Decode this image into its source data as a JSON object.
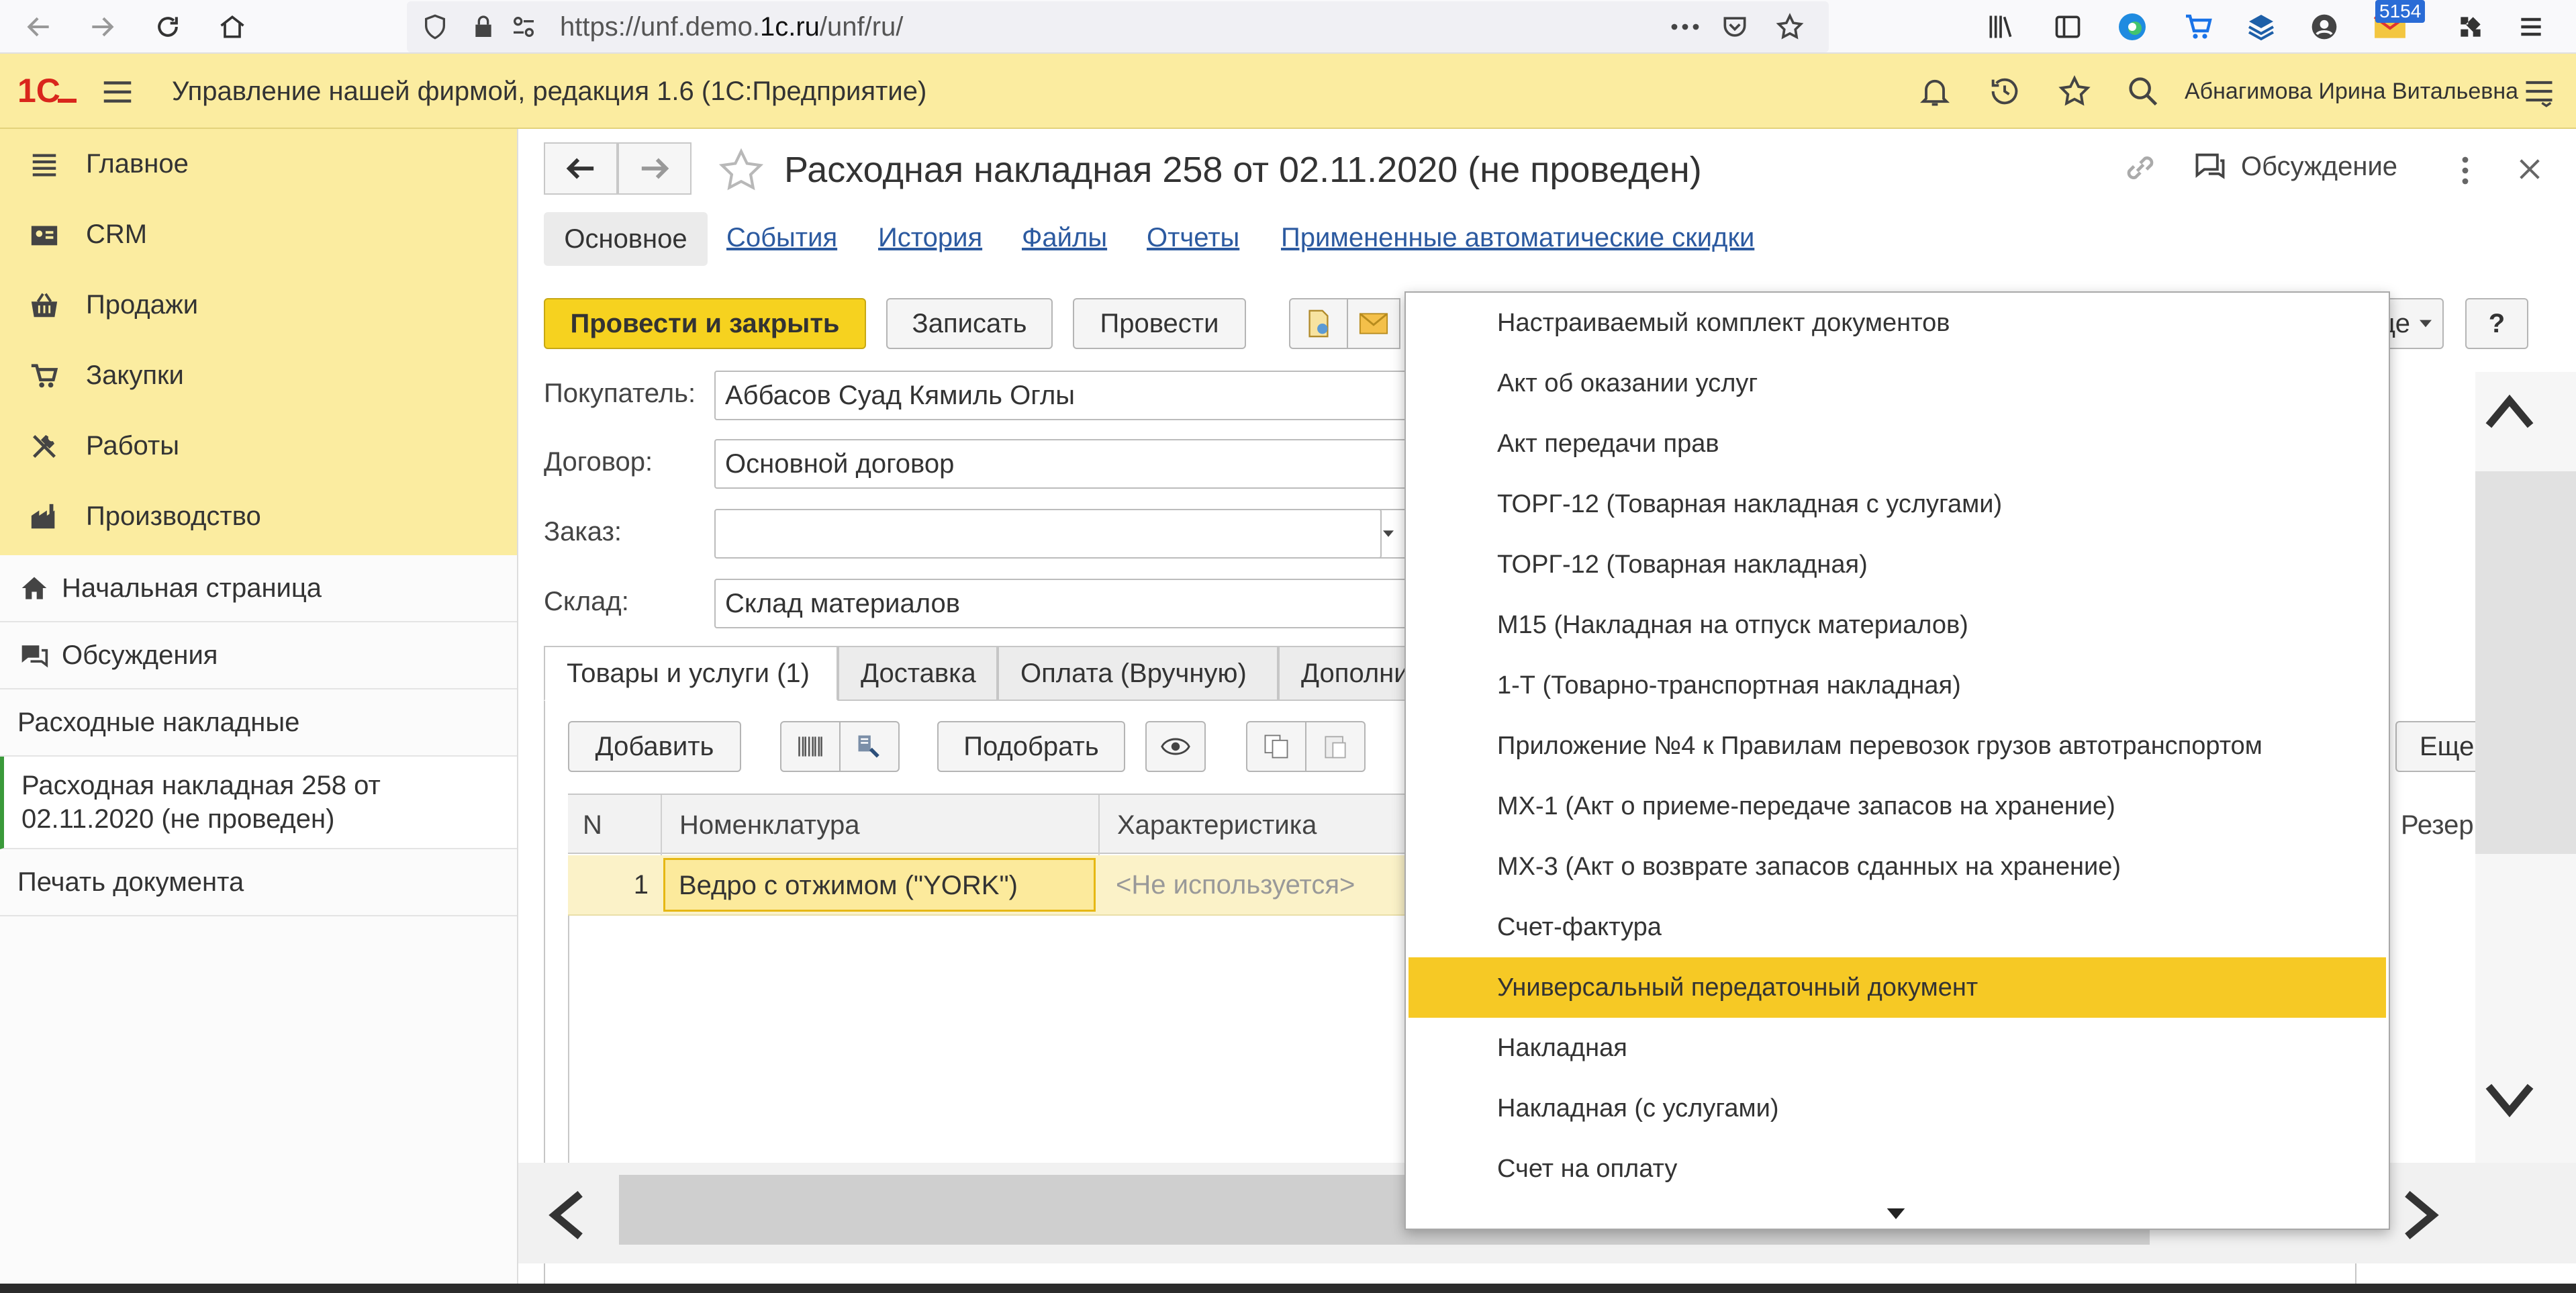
{
  "browser": {
    "url_prefix": "https://unf.demo.",
    "url_domain": "1c.ru",
    "url_suffix": "/unf/ru/",
    "badge": "5154"
  },
  "app": {
    "title": "Управление нашей фирмой, редакция 1.6  (1С:Предприятие)",
    "user": "Абнагимова Ирина Витальевна",
    "brand_color": "#fbeca0",
    "accent_color": "#f6d21f"
  },
  "sidebar": {
    "sections": [
      {
        "label": "Главное",
        "icon": "menu-lines-icon"
      },
      {
        "label": "CRM",
        "icon": "contact-card-icon"
      },
      {
        "label": "Продажи",
        "icon": "basket-icon"
      },
      {
        "label": "Закупки",
        "icon": "cart-icon"
      },
      {
        "label": "Работы",
        "icon": "tools-icon"
      },
      {
        "label": "Производство",
        "icon": "factory-icon"
      }
    ],
    "nav": {
      "home": "Начальная страница",
      "discussions": "Обсуждения",
      "list": "Расходные накладные",
      "current": "Расходная накладная 258 от 02.11.2020 (не проведен)",
      "print": "Печать документа"
    }
  },
  "form": {
    "title": "Расходная накладная 258 от 02.11.2020 (не проведен)",
    "discussion_label": "Обсуждение",
    "tabs": [
      "Основное",
      "События",
      "История",
      "Файлы",
      "Отчеты",
      "Примененные автоматические скидки"
    ],
    "buttons": {
      "post_close": "Провести и закрыть",
      "save": "Записать",
      "post": "Провести",
      "more_partial": "ще",
      "help": "?"
    },
    "fields": {
      "buyer_label": "Покупатель:",
      "buyer_value": "Аббасов Суад Кямиль Оглы",
      "contract_label": "Договор:",
      "contract_value": "Основной договор",
      "order_label": "Заказ:",
      "order_value": "",
      "warehouse_label": "Склад:",
      "warehouse_value": "Склад материалов"
    },
    "panel_tabs": [
      "Товары и услуги (1)",
      "Доставка",
      "Оплата (Вручную)",
      "Дополни"
    ],
    "table_buttons": {
      "add": "Добавить",
      "pick": "Подобрать",
      "more": "Еще"
    },
    "grid": {
      "columns": [
        "N",
        "Номенклатура",
        "Характеристика",
        "Резерва"
      ],
      "rows": [
        {
          "n": "1",
          "item": "Ведро с отжимом (\"YORK\")",
          "characteristic": "<Не используется>"
        }
      ]
    }
  },
  "print_menu": {
    "items": [
      "Настраиваемый комплект документов",
      "Акт об оказании услуг",
      "Акт передачи прав",
      "ТОРГ-12 (Товарная накладная с услугами)",
      "ТОРГ-12 (Товарная накладная)",
      "М15 (Накладная на отпуск материалов)",
      "1-Т (Товарно-транспортная накладная)",
      "Приложение №4 к Правилам перевозок грузов автотранспортом",
      "МХ-1 (Акт о приеме-передаче запасов на хранение)",
      "МХ-3 (Акт о возврате запасов сданных на хранение)",
      "Счет-фактура",
      "Универсальный передаточный документ",
      "Накладная",
      "Накладная (с услугами)",
      "Счет на оплату"
    ],
    "selected_index": 11,
    "highlight_color": "#f6c925"
  }
}
